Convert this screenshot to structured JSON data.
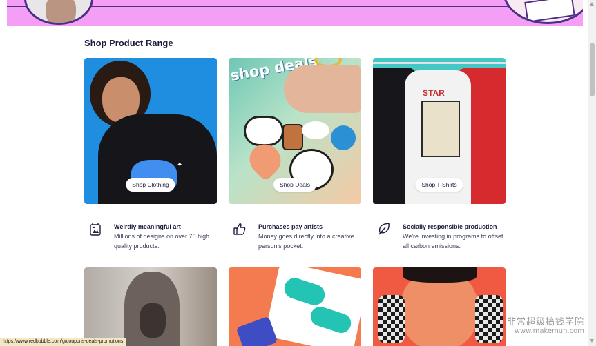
{
  "section": {
    "title": "Shop Product Range"
  },
  "cards": [
    {
      "pill_label": "Shop Clothing"
    },
    {
      "pill_label": "Shop Deals",
      "image_text": "shop deals"
    },
    {
      "pill_label": "Shop T-Shirts",
      "image_text": "STAR"
    }
  ],
  "features": [
    {
      "icon": "tag-icon",
      "title": "Weirdly meaningful art",
      "description": "Millions of designs on over 70 high quality products."
    },
    {
      "icon": "thumbs-up-icon",
      "title": "Purchases pay artists",
      "description": "Money goes directly into a creative person's pocket."
    },
    {
      "icon": "leaf-icon",
      "title": "Socially responsible production",
      "description": "We're investing in programs to offset all carbon emissions."
    }
  ],
  "status_bar": {
    "url": "https://www.redbubble.com/g/coupons-deals-promotions"
  },
  "watermark": {
    "line1": "非常超级搞钱学院",
    "line2": "www.makemun.com"
  },
  "colors": {
    "banner": "#f59ef5",
    "heading": "#1c1d3d",
    "card_clothing_bg": "#1f8de0",
    "card_tshirts_bg": "#44c8c6"
  }
}
